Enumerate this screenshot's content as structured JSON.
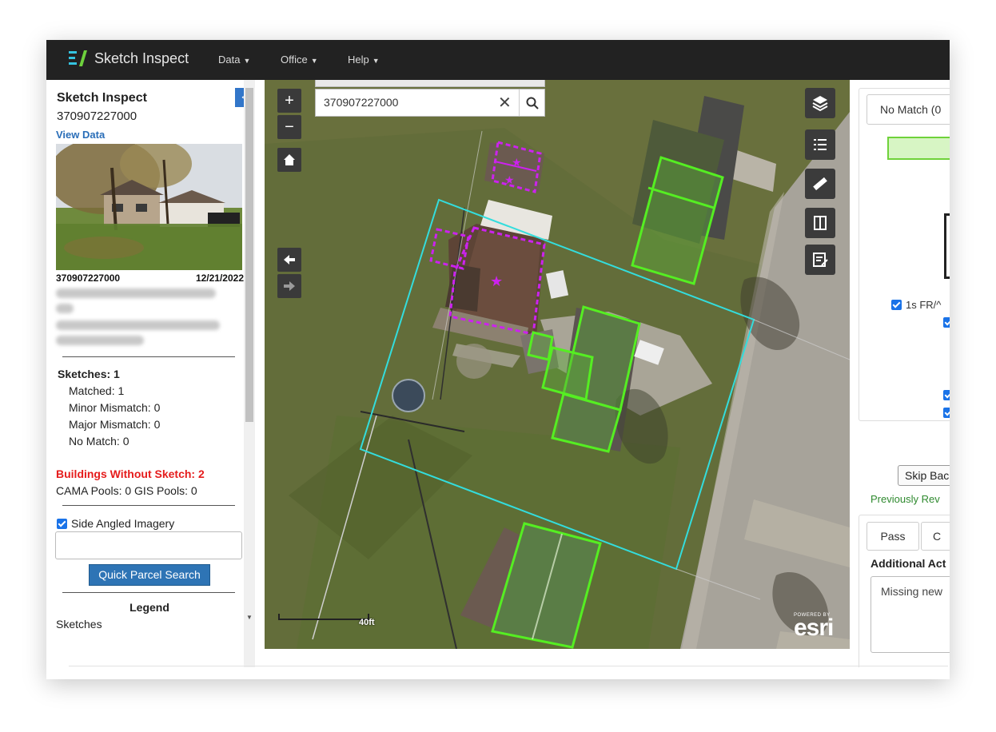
{
  "app": {
    "title": "Sketch Inspect",
    "menus": [
      {
        "label": "Data"
      },
      {
        "label": "Office"
      },
      {
        "label": "Help"
      }
    ]
  },
  "left_panel": {
    "title": "Sketch Inspect",
    "parcel_id": "370907227000",
    "view_data": "View Data",
    "collapse": "<",
    "photo_caption": {
      "id": "370907227000",
      "date": "12/21/2022"
    },
    "sketches_heading": "Sketches: 1",
    "stats": {
      "matched": "Matched: 1",
      "minor": "Minor Mismatch: 0",
      "major": "Major Mismatch: 0",
      "nomatch": "No Match: 0"
    },
    "buildings_without": "Buildings Without Sketch: 2",
    "pools": "CAMA Pools: 0 GIS Pools: 0",
    "side_angled": "Side Angled Imagery",
    "quick_search": "Quick Parcel Search",
    "legend": "Legend",
    "legend_item": "Sketches"
  },
  "map": {
    "search_value": "370907227000",
    "scale_label": "40ft",
    "powered_by": "POWERED BY",
    "esri": "esri"
  },
  "right_panel": {
    "tab_no_match": "No Match (0",
    "fr_label": "1s FR/^",
    "skip_back": "Skip Bac",
    "previously": "Previously Rev",
    "tab_pass": "Pass",
    "tab_c": "C",
    "additional": "Additional Act",
    "notes": "Missing new"
  },
  "colors": {
    "topbar": "#222222",
    "accent_blue": "#2e74b5",
    "sketch_green": "#55ee22",
    "parcel_cyan": "#33dddd",
    "building_magenta": "#cc22ee",
    "alert_red": "#e51c1c"
  }
}
